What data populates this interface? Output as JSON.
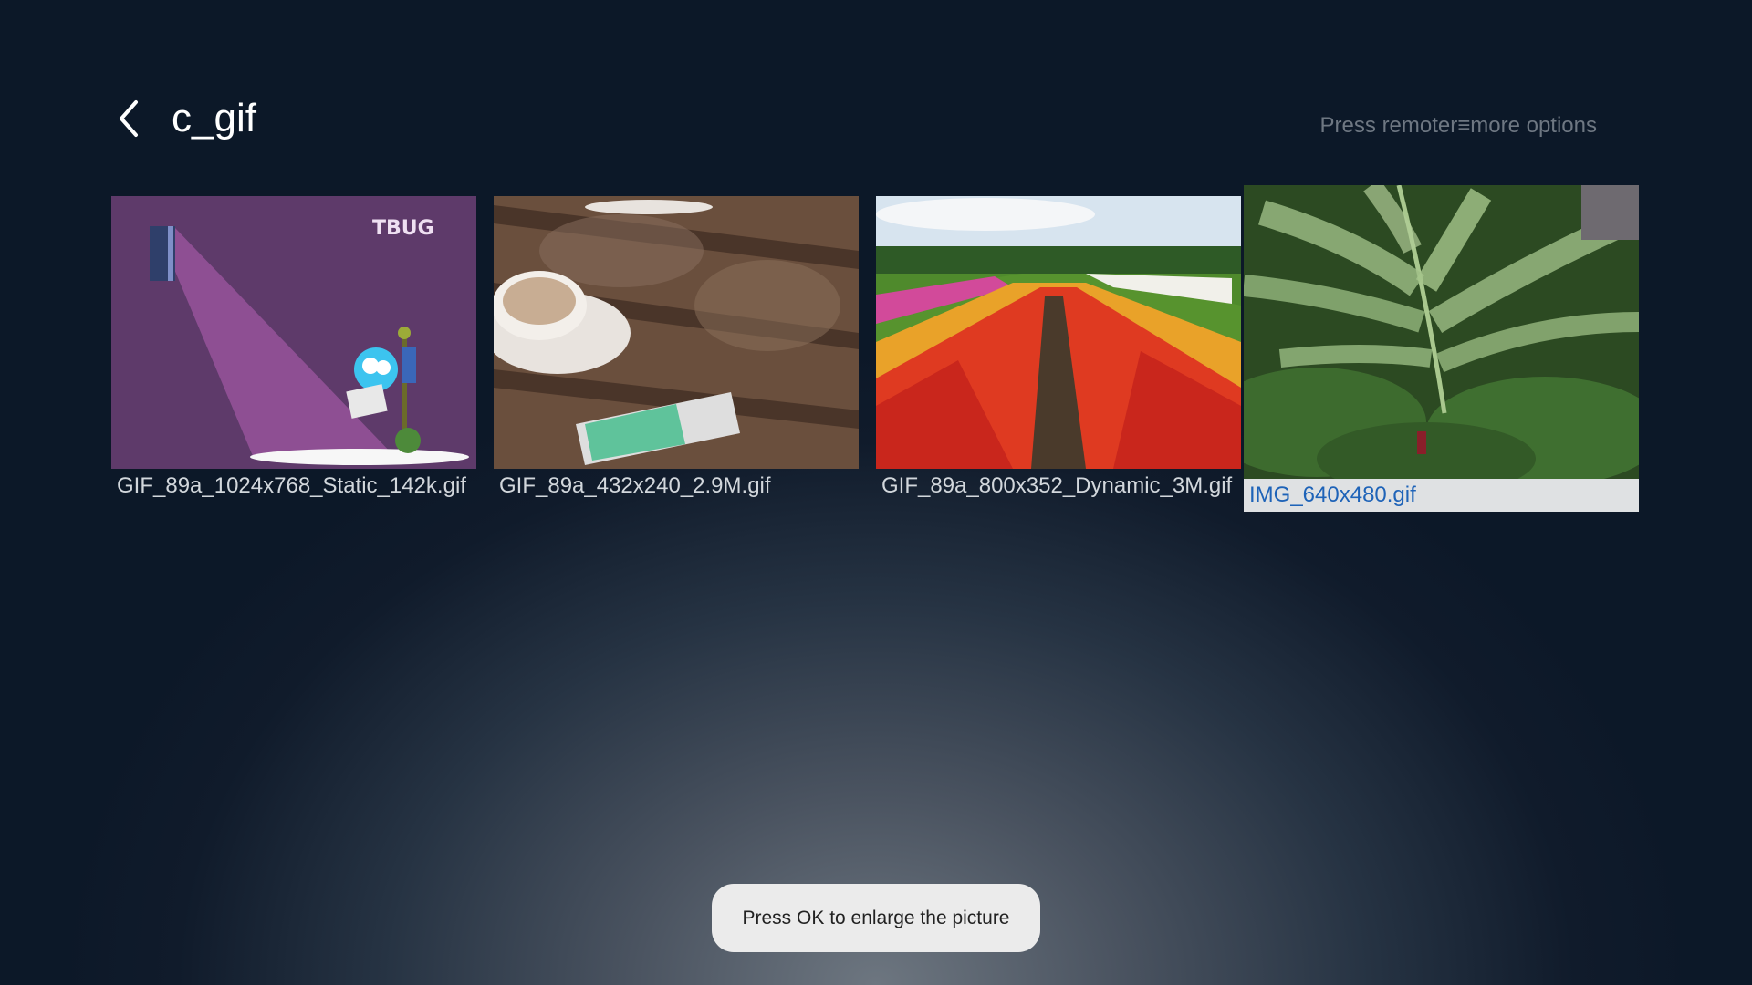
{
  "header": {
    "title": "c_gif",
    "hint": "Press remoter≡more options"
  },
  "tiles": [
    {
      "name": "GIF_89a_1024x768_Static_142k.gif",
      "focused": false
    },
    {
      "name": "GIF_89a_432x240_2.9M.gif",
      "focused": false
    },
    {
      "name": "GIF_89a_800x352_Dynamic_3M.gif",
      "focused": false
    },
    {
      "name": "IMG_640x480.gif",
      "focused": true
    }
  ],
  "toast": "Press OK to enlarge the picture",
  "colors": {
    "focus_text": "#1e63b8",
    "caption_text": "#d2d7dc",
    "background": "#0c1828"
  }
}
